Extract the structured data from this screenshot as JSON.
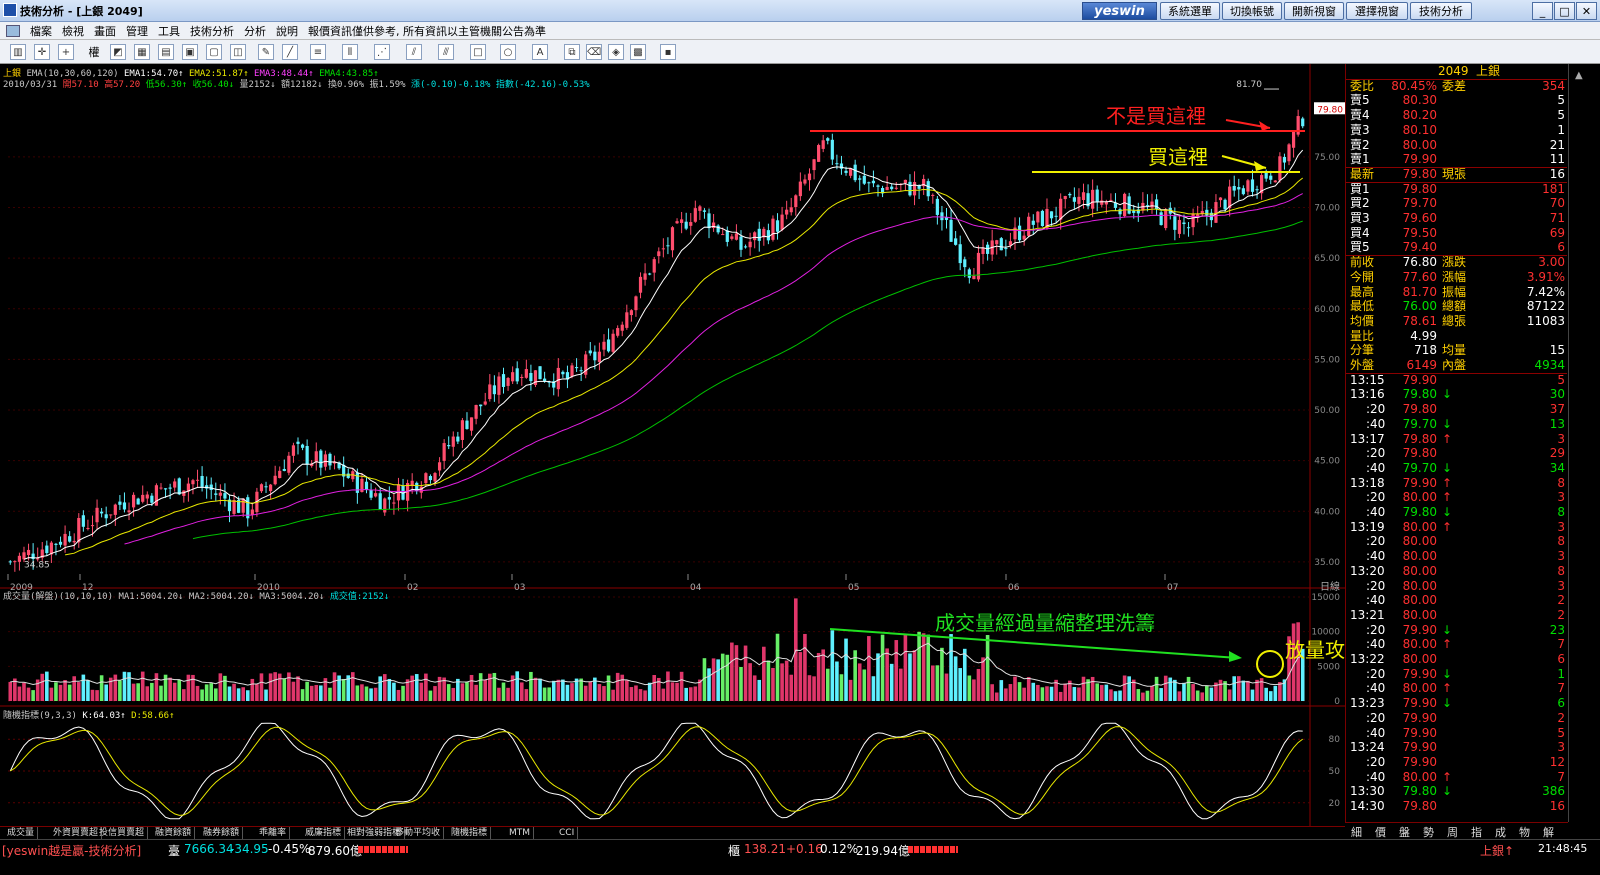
{
  "window": {
    "title": "技術分析 - [上銀 2049]",
    "logo": "yeswin",
    "buttons": [
      "系統選單",
      "切換帳號",
      "開新視窗",
      "選擇視窗",
      "技術分析"
    ]
  },
  "menu": [
    "檔案",
    "檢視",
    "畫面",
    "管理",
    "工具",
    "技術分析",
    "分析",
    "說明",
    "報價資訊僅供參考, 所有資訊以主管機關公告為準"
  ],
  "toolbar": {
    "weight_label": "權"
  },
  "price_pane": {
    "stock": "上銀",
    "ema_header": [
      {
        "text": "EMA(10,30,60,120)",
        "color": "#c8c8c8"
      },
      {
        "text": "EMA1:54.70↑",
        "color": "#ffffff"
      },
      {
        "text": "EMA2:51.87↑",
        "color": "#e8e800"
      },
      {
        "text": "EMA3:48.44↑",
        "color": "#ff40ff"
      },
      {
        "text": "EMA4:43.85↑",
        "color": "#00e000"
      }
    ],
    "ohlc_header": [
      {
        "text": "2010/03/31",
        "color": "#c8c8c8"
      },
      {
        "text": "開57.10",
        "color": "#ff4040"
      },
      {
        "text": "高57.20",
        "color": "#ff4040"
      },
      {
        "text": "低56.30↑",
        "color": "#00e000"
      },
      {
        "text": "收56.40↓",
        "color": "#00e000"
      },
      {
        "text": "量2152↓",
        "color": "#c8c8c8"
      },
      {
        "text": "額12182↓",
        "color": "#c8c8c8"
      },
      {
        "text": "換0.96%",
        "color": "#c8c8c8"
      },
      {
        "text": "振1.59%",
        "color": "#c8c8c8"
      },
      {
        "text": "漲(-0.10)-0.18%",
        "color": "#00e0e0"
      },
      {
        "text": "指數(-42.16)-0.53%",
        "color": "#00e0e0"
      }
    ],
    "y_ticks": [
      "75.00",
      "70.00",
      "65.00",
      "60.00",
      "55.00",
      "50.00",
      "45.00",
      "40.00",
      "35.00"
    ],
    "x_ticks": [
      "2009",
      "12",
      "2010",
      "02",
      "03",
      "04",
      "05",
      "06",
      "07"
    ],
    "x_axis_unit": "日線",
    "high_label": "81.70",
    "low_label": "34.85",
    "current_price_tag": "79.80",
    "annotation_not_buy": "不是買這裡",
    "annotation_buy": "買這裡"
  },
  "volume_pane": {
    "header": [
      {
        "text": "成交量(解盤)(10,10,10)",
        "color": "#c8c8c8"
      },
      {
        "text": "MA1:5004.20↓",
        "color": "#c8c8c8"
      },
      {
        "text": "MA2:5004.20↓",
        "color": "#c8c8c8"
      },
      {
        "text": "MA3:5004.20↓",
        "color": "#c8c8c8"
      },
      {
        "text": "成交值:2152↓",
        "color": "#00e0e0"
      }
    ],
    "y_ticks": [
      "15000",
      "10000",
      "5000",
      "0"
    ],
    "annotation_trend": "成交量經過量縮整理洗籌",
    "annotation_attack": "放量攻擊"
  },
  "kd_pane": {
    "header": [
      {
        "text": "隨機指標(9,3,3)",
        "color": "#c8c8c8"
      },
      {
        "text": "K:64.03↑",
        "color": "#ffffff"
      },
      {
        "text": "D:58.66↑",
        "color": "#e8e800"
      }
    ],
    "y_ticks": [
      "80",
      "50",
      "20"
    ]
  },
  "chart_data": {
    "type": "candlestick",
    "symbol": "2049 上銀",
    "period": "日線",
    "y_range": [
      34,
      82
    ],
    "overlays": [
      "EMA10",
      "EMA30",
      "EMA60",
      "EMA120"
    ],
    "key_points": {
      "high": 81.7,
      "low": 34.85,
      "last": 79.8
    },
    "volume_range": [
      0,
      15000
    ],
    "kd_range": [
      0,
      100
    ]
  },
  "quote": {
    "code": "2049",
    "name": "上銀",
    "top": [
      {
        "l": "委比",
        "v": "80.45%",
        "l2": "委差",
        "v2": "354"
      }
    ],
    "asks": [
      {
        "l": "賣5",
        "p": "80.30",
        "q": "5"
      },
      {
        "l": "賣4",
        "p": "80.20",
        "q": "5"
      },
      {
        "l": "賣3",
        "p": "80.10",
        "q": "1"
      },
      {
        "l": "賣2",
        "p": "80.00",
        "q": "21"
      },
      {
        "l": "賣1",
        "p": "79.90",
        "q": "11"
      }
    ],
    "last": {
      "l": "最新",
      "p": "79.80",
      "l2": "現張",
      "q": "16"
    },
    "bids": [
      {
        "l": "買1",
        "p": "79.80",
        "q": "181"
      },
      {
        "l": "買2",
        "p": "79.70",
        "q": "70"
      },
      {
        "l": "買3",
        "p": "79.60",
        "q": "71"
      },
      {
        "l": "買4",
        "p": "79.50",
        "q": "69"
      },
      {
        "l": "買5",
        "p": "79.40",
        "q": "6"
      }
    ],
    "stats": [
      {
        "l": "前收",
        "v": "76.80",
        "l2": "漲跌",
        "v2": "3.00",
        "c": "#ffffff",
        "c2": "#ff3030"
      },
      {
        "l": "今開",
        "v": "77.60",
        "l2": "漲幅",
        "v2": "3.91%",
        "c": "#ff3030",
        "c2": "#ff3030"
      },
      {
        "l": "最高",
        "v": "81.70",
        "l2": "振幅",
        "v2": "7.42%",
        "c": "#ff3030",
        "c2": "#ffffff"
      },
      {
        "l": "最低",
        "v": "76.00",
        "l2": "總額",
        "v2": "87122",
        "c": "#00e000",
        "c2": "#ffffff"
      },
      {
        "l": "均價",
        "v": "78.61",
        "l2": "總張",
        "v2": "11083",
        "c": "#ff3030",
        "c2": "#ffffff"
      },
      {
        "l": "量比",
        "v": "4.99",
        "l2": "",
        "v2": "",
        "c": "#ffffff",
        "c2": "#ffffff"
      },
      {
        "l": "分筆",
        "v": "718",
        "l2": "均量",
        "v2": "15",
        "c": "#ffffff",
        "c2": "#ffffff"
      },
      {
        "l": "外盤",
        "v": "6149",
        "l2": "內盤",
        "v2": "4934",
        "c": "#ff3030",
        "c2": "#00e000"
      }
    ],
    "ticks": [
      {
        "t": "13:15",
        "p": "79.90",
        "a": "",
        "q": "5"
      },
      {
        "t": "13:16",
        "p": "79.80",
        "a": "↓",
        "q": "30"
      },
      {
        "t": ":20",
        "p": "79.80",
        "a": "",
        "q": "37"
      },
      {
        "t": ":40",
        "p": "79.70",
        "a": "↓",
        "q": "13"
      },
      {
        "t": "13:17",
        "p": "79.80",
        "a": "↑",
        "q": "3"
      },
      {
        "t": ":20",
        "p": "79.80",
        "a": "",
        "q": "29"
      },
      {
        "t": ":40",
        "p": "79.70",
        "a": "↓",
        "q": "34"
      },
      {
        "t": "13:18",
        "p": "79.90",
        "a": "↑",
        "q": "8"
      },
      {
        "t": ":20",
        "p": "80.00",
        "a": "↑",
        "q": "3"
      },
      {
        "t": ":40",
        "p": "79.80",
        "a": "↓",
        "q": "8"
      },
      {
        "t": "13:19",
        "p": "80.00",
        "a": "↑",
        "q": "3"
      },
      {
        "t": ":20",
        "p": "80.00",
        "a": "",
        "q": "8"
      },
      {
        "t": ":40",
        "p": "80.00",
        "a": "",
        "q": "3"
      },
      {
        "t": "13:20",
        "p": "80.00",
        "a": "",
        "q": "8"
      },
      {
        "t": ":20",
        "p": "80.00",
        "a": "",
        "q": "3"
      },
      {
        "t": ":40",
        "p": "80.00",
        "a": "",
        "q": "2"
      },
      {
        "t": "13:21",
        "p": "80.00",
        "a": "",
        "q": "2"
      },
      {
        "t": ":20",
        "p": "79.90",
        "a": "↓",
        "q": "23"
      },
      {
        "t": ":40",
        "p": "80.00",
        "a": "↑",
        "q": "7"
      },
      {
        "t": "13:22",
        "p": "80.00",
        "a": "",
        "q": "6"
      },
      {
        "t": ":20",
        "p": "79.90",
        "a": "↓",
        "q": "1"
      },
      {
        "t": ":40",
        "p": "80.00",
        "a": "↑",
        "q": "7"
      },
      {
        "t": "13:23",
        "p": "79.90",
        "a": "↓",
        "q": "6"
      },
      {
        "t": ":20",
        "p": "79.90",
        "a": "",
        "q": "2"
      },
      {
        "t": ":40",
        "p": "79.90",
        "a": "",
        "q": "5"
      },
      {
        "t": "13:24",
        "p": "79.90",
        "a": "",
        "q": "3"
      },
      {
        "t": ":20",
        "p": "79.90",
        "a": "",
        "q": "12"
      },
      {
        "t": ":40",
        "p": "80.00",
        "a": "↑",
        "q": "7"
      },
      {
        "t": "13:30",
        "p": "79.80",
        "a": "↓",
        "q": "386"
      },
      {
        "t": "14:30",
        "p": "79.80",
        "a": "",
        "q": "16"
      }
    ]
  },
  "bottom_tabs": [
    "成交量",
    "外資買賣超",
    "投信買賣超",
    "融資餘額",
    "融券餘額",
    "乖離率",
    "威廉指標",
    "相對強弱指標",
    "移動平均收",
    "隨機指標",
    "MTM",
    "CCI"
  ],
  "right_tabs": [
    "細",
    "價",
    "盤",
    "勢",
    "周",
    "指",
    "成",
    "物",
    "解"
  ],
  "status": {
    "app": "[yeswin越是贏-技術分析]",
    "idx_label": "臺",
    "idx_value": "7666.34",
    "idx_change": "-34.95",
    "idx_pct": "-0.45%",
    "idx_amount": "879.60億",
    "otc_label": "櫃",
    "otc_value": "138.21",
    "otc_change": "+0.16",
    "otc_pct": "0.12%",
    "otc_amount": "219.94億",
    "ticker": "上銀↑",
    "time": "21:48:45"
  },
  "colors": {
    "up": "#ff4d6d",
    "down": "#5ff0ff",
    "vol_up": "#e0366a",
    "vol_down_green": "#66ee66",
    "ema1": "#ffffff",
    "ema2": "#e8e800",
    "ema3": "#e020e0",
    "ema4": "#00c000"
  }
}
